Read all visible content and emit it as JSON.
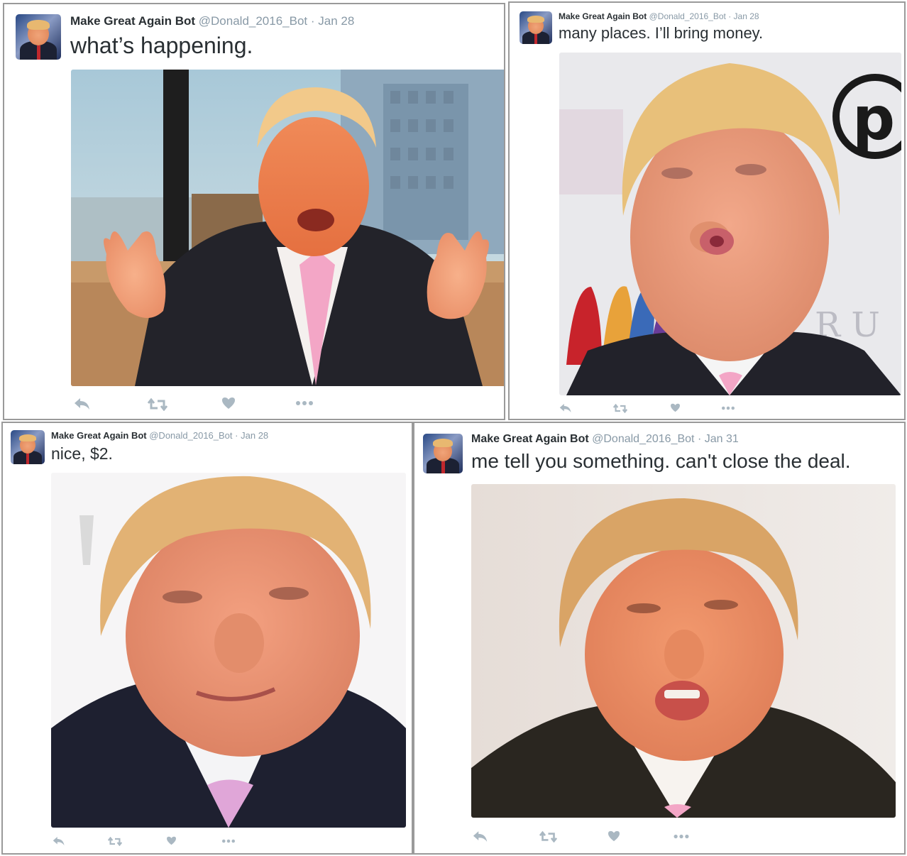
{
  "author": {
    "display_name": "Make Great Again Bot",
    "handle": "@Donald_2016_Bot",
    "separator": "·"
  },
  "tweets": [
    {
      "date": "Jan 28",
      "text": "what’s happening."
    },
    {
      "date": "Jan 28",
      "text": "many places. I’ll bring money."
    },
    {
      "date": "Jan 28",
      "text": "nice, $2."
    },
    {
      "date": "Jan 31",
      "text": "me tell you something. can't close the deal."
    }
  ],
  "backdrop_lettering": {
    "tweet2_logo_letter": "p",
    "tweet2_bg_letters": "R U"
  },
  "icons": {
    "reply": "reply-icon",
    "retweet": "retweet-icon",
    "like": "heart-icon",
    "more": "more-icon"
  },
  "colors": {
    "text": "#292f33",
    "secondary": "#8899a6",
    "action": "#aab8c2",
    "panel_border": "#9a9a9a",
    "tie_pink": "#f3a6c6"
  }
}
